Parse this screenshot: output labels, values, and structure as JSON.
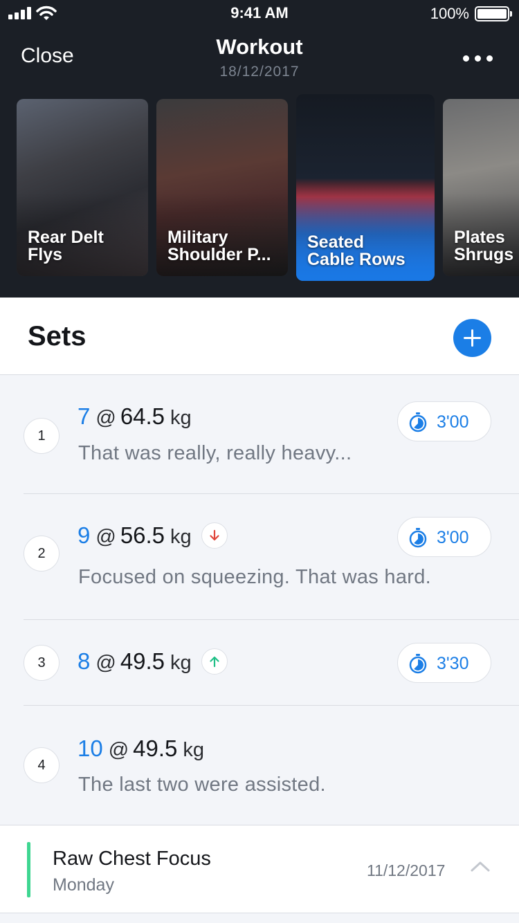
{
  "status_bar": {
    "time": "9:41 AM",
    "battery": "100%"
  },
  "nav": {
    "close_label": "Close",
    "title": "Workout",
    "date": "18/12/2017"
  },
  "exercises": [
    {
      "label": "Rear Delt\nFlys",
      "selected": false
    },
    {
      "label": "Military\nShoulder P...",
      "selected": false
    },
    {
      "label": "Seated\nCable Rows",
      "selected": true
    },
    {
      "label": "Plates\nShrugs",
      "selected": false
    }
  ],
  "sets_section": {
    "title": "Sets",
    "sets": [
      {
        "number": "1",
        "reps": "7",
        "at": "@",
        "weight": "64.5",
        "unit": "kg",
        "trend": "",
        "note": "That was really, really heavy...",
        "timer": "3'00"
      },
      {
        "number": "2",
        "reps": "9",
        "at": "@",
        "weight": "56.5",
        "unit": "kg",
        "trend": "down",
        "note": "Focused on squeezing. That was hard.",
        "timer": "3'00"
      },
      {
        "number": "3",
        "reps": "8",
        "at": "@",
        "weight": "49.5",
        "unit": "kg",
        "trend": "up",
        "note": "",
        "timer": "3'30"
      },
      {
        "number": "4",
        "reps": "10",
        "at": "@",
        "weight": "49.5",
        "unit": "kg",
        "trend": "",
        "note": "The last two were assisted.",
        "timer": ""
      }
    ]
  },
  "previous_workout": {
    "name": "Raw Chest Focus",
    "day": "Monday",
    "date": "11/12/2017"
  },
  "colors": {
    "accent": "#1b7ee6",
    "header_bg": "#1b1f26",
    "trend_down": "#e0453a",
    "trend_up": "#1fbf86",
    "previous_bar": "#3ed691"
  }
}
